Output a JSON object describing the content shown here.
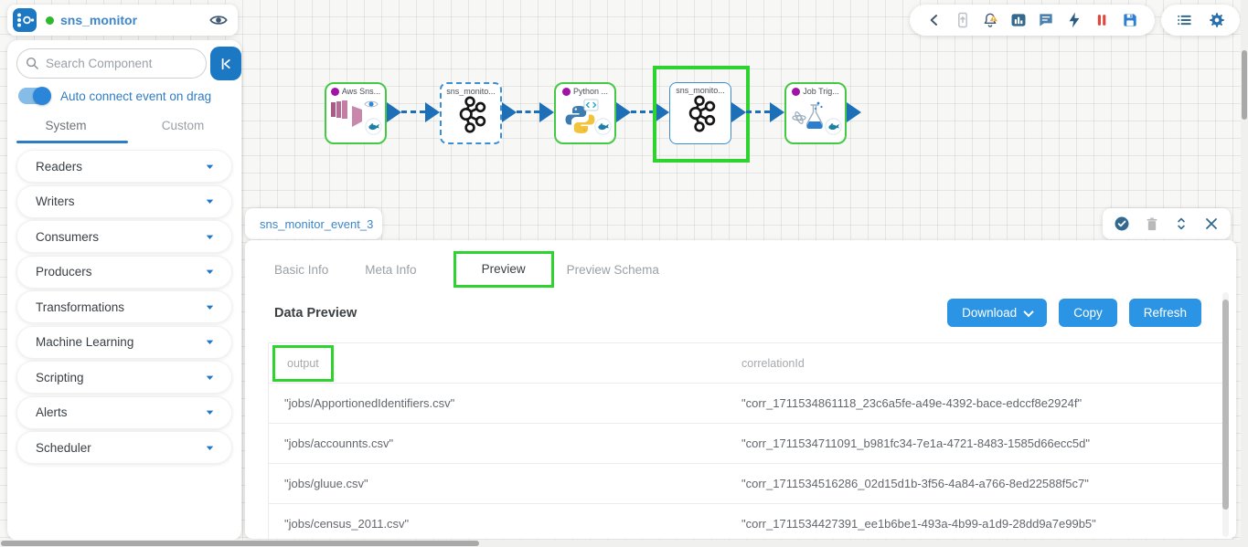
{
  "app": {
    "title": "sns_monitor",
    "status": "running"
  },
  "sidebar": {
    "search_placeholder": "Search Component",
    "toggle_label": "Auto connect event on drag",
    "toggle_state": "on",
    "tabs": [
      {
        "label": "System",
        "active": true
      },
      {
        "label": "Custom",
        "active": false
      }
    ],
    "categories": [
      "Readers",
      "Writers",
      "Consumers",
      "Producers",
      "Transformations",
      "Machine Learning",
      "Scripting",
      "Alerts",
      "Scheduler"
    ]
  },
  "top_toolbar": {
    "main_icons": [
      "chevron-left-icon",
      "mobile-upload-icon",
      "alerts-bell-icon",
      "bar-chart-icon",
      "comments-icon",
      "lightning-icon",
      "pause-icon",
      "save-icon"
    ],
    "side_icons": [
      "list-view-icon",
      "settings-gear-icon"
    ]
  },
  "pipeline": {
    "nodes": [
      {
        "label": "Aws Sns...",
        "icon": "aws-sns-icon",
        "kind": "component",
        "badges": [
          "eye-icon",
          "whale-icon"
        ],
        "highlighted": false
      },
      {
        "label": "sns_monito...",
        "icon": "kafka-icon",
        "kind": "event-dashed",
        "badges": [],
        "highlighted": false
      },
      {
        "label": "Python ...",
        "icon": "python-icon",
        "kind": "component",
        "badges": [
          "whale-icon"
        ],
        "highlighted": false
      },
      {
        "label": "sns_monito...",
        "icon": "kafka-icon",
        "kind": "event-solid",
        "badges": [],
        "highlighted": true
      },
      {
        "label": "Job Trig...",
        "icon": "job-trigger-icon",
        "kind": "component",
        "badges": [
          "whale-icon"
        ],
        "highlighted": false
      }
    ]
  },
  "inspector": {
    "event_tab_title": "sns_monitor_event_3",
    "action_icons": [
      "status-check-icon",
      "delete-icon",
      "resize-icon",
      "close-icon"
    ],
    "tabs": [
      "Basic Info",
      "Meta Info",
      "Preview",
      "Preview Schema"
    ],
    "active_tab": "Preview",
    "section_title": "Data Preview",
    "download_label": "Download",
    "copy_label": "Copy",
    "refresh_label": "Refresh",
    "table": {
      "columns": [
        "output",
        "correlationId"
      ],
      "highlighted_column": "output",
      "rows": [
        [
          "\"jobs/ApportionedIdentifiers.csv\"",
          "\"corr_1711534861118_23c6a5fe-a49e-4392-bace-edccf8e2924f\""
        ],
        [
          "\"jobs/accounnts.csv\"",
          "\"corr_1711534711091_b981fc34-7e1a-4721-8483-1585d66ecc5d\""
        ],
        [
          "\"jobs/gluue.csv\"",
          "\"corr_1711534516286_02d15d1b-3f56-4a84-a766-8ed22588f5c7\""
        ],
        [
          "\"jobs/census_2011.csv\"",
          "\"corr_1711534427391_ee1b6be1-493a-4b99-a1d9-28dd9a7e99b5\""
        ]
      ]
    }
  },
  "colors": {
    "brand_blue": "#1d78c4",
    "accent_blue": "#2b94e4",
    "link_blue": "#3d87c8",
    "connector_blue": "#1d6fb8",
    "node_green": "#44c944",
    "highlight_green": "#2fd32f",
    "status_green": "#2eb92e",
    "magenta_dot": "#a113a6",
    "pause_red": "#e0483d"
  }
}
